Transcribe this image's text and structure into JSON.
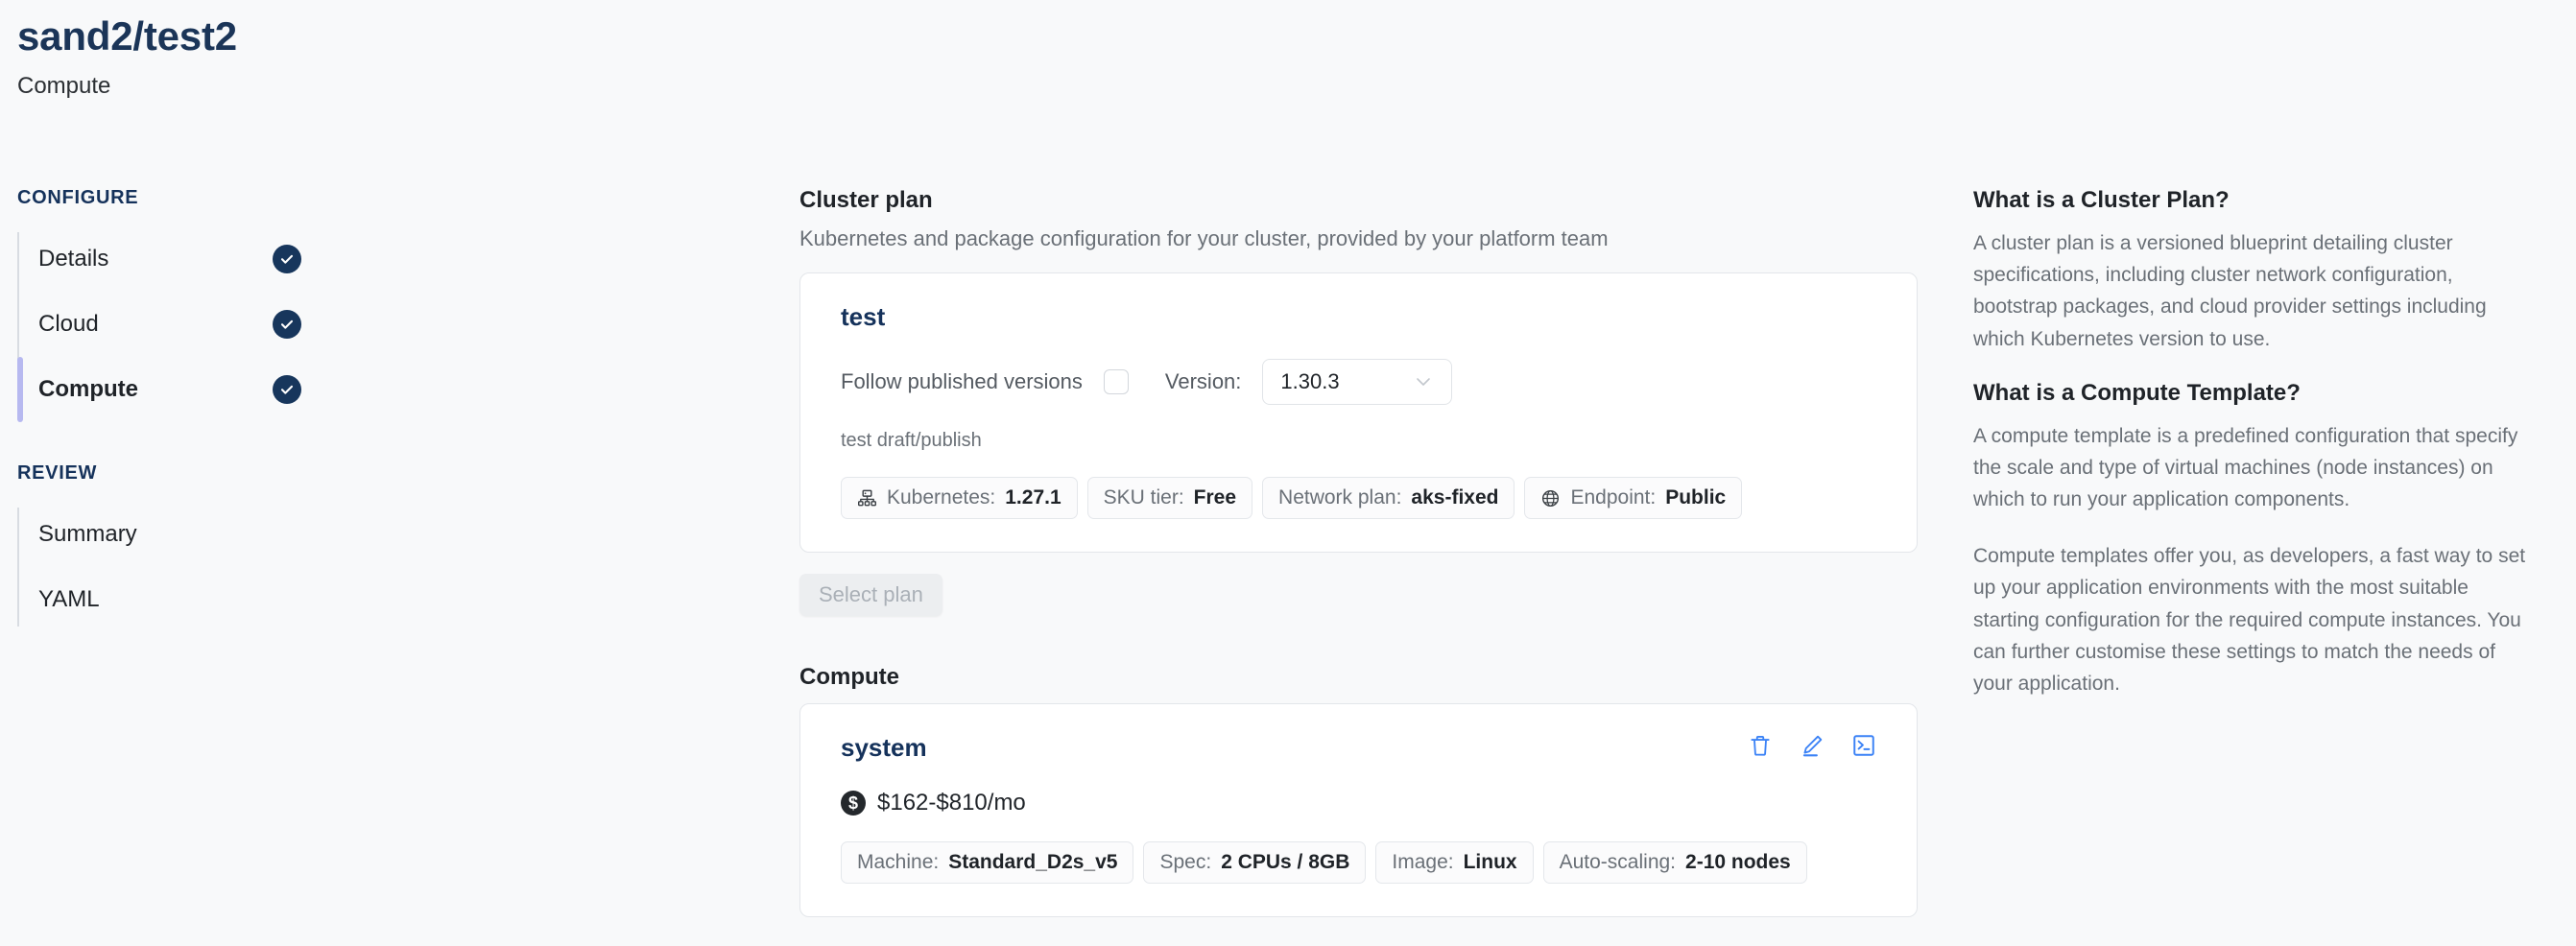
{
  "header": {
    "title": "sand2/test2",
    "subtitle": "Compute"
  },
  "sidebar": {
    "groups": [
      {
        "label": "CONFIGURE",
        "items": [
          {
            "label": "Details",
            "checked": true,
            "active": false
          },
          {
            "label": "Cloud",
            "checked": true,
            "active": false
          },
          {
            "label": "Compute",
            "checked": true,
            "active": true
          }
        ]
      },
      {
        "label": "REVIEW",
        "items": [
          {
            "label": "Summary",
            "checked": false,
            "active": false
          },
          {
            "label": "YAML",
            "checked": false,
            "active": false
          }
        ]
      }
    ]
  },
  "cluster_plan": {
    "section_title": "Cluster plan",
    "section_desc": "Kubernetes and package configuration for your cluster, provided by your platform team",
    "card_title": "test",
    "follow_label": "Follow published versions",
    "follow_checked": false,
    "version_label": "Version:",
    "version_value": "1.30.3",
    "draft_line": "test draft/publish",
    "pills": [
      {
        "icon": "sitemap-icon",
        "key": "Kubernetes:",
        "value": "1.27.1"
      },
      {
        "icon": "",
        "key": "SKU tier:",
        "value": "Free"
      },
      {
        "icon": "",
        "key": "Network plan:",
        "value": "aks-fixed"
      },
      {
        "icon": "globe-icon",
        "key": "Endpoint:",
        "value": "Public"
      }
    ],
    "select_plan_label": "Select plan",
    "select_plan_disabled": true
  },
  "compute": {
    "section_title": "Compute",
    "card_title": "system",
    "price": "$162-$810/mo",
    "currency_symbol": "$",
    "actions": [
      {
        "name": "delete-icon",
        "title": "Delete"
      },
      {
        "name": "edit-icon",
        "title": "Edit"
      },
      {
        "name": "terminal-icon",
        "title": "Console"
      }
    ],
    "pills": [
      {
        "key": "Machine:",
        "value": "Standard_D2s_v5"
      },
      {
        "key": "Spec:",
        "value": "2 CPUs / 8GB"
      },
      {
        "key": "Image:",
        "value": "Linux"
      },
      {
        "key": "Auto-scaling:",
        "value": "2-10 nodes"
      }
    ]
  },
  "info_panel": {
    "blocks": [
      {
        "heading": "What is a Cluster Plan?",
        "paragraphs": [
          "A cluster plan is a versioned blueprint detailing cluster specifications, including cluster network configuration, bootstrap packages, and cloud provider settings including which Kubernetes version to use."
        ]
      },
      {
        "heading": "What is a Compute Template?",
        "paragraphs": [
          "A compute template is a predefined configuration that specify the scale and type of virtual machines (node instances) on which to run your application components.",
          "Compute templates offer you, as developers, a fast way to set up your application environments with the most suitable starting configuration for the required compute instances. You can further customise these settings to match the needs of your application."
        ]
      }
    ]
  },
  "colors": {
    "page_bg": "#f8f9fa",
    "navy": "#15325b",
    "accent_blue": "#3b82f6",
    "active_marker": "#b7b9f0",
    "muted_text": "#6a7077"
  }
}
